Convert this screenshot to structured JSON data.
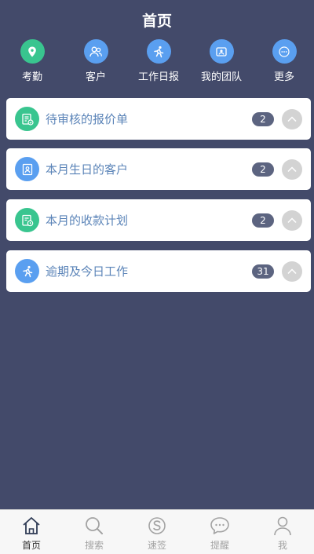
{
  "header": {
    "title": "首页"
  },
  "quick_actions": [
    {
      "label": "考勤",
      "icon": "location-pin-icon",
      "color": "#39c58f"
    },
    {
      "label": "客户",
      "icon": "people-icon",
      "color": "#5a9ff0"
    },
    {
      "label": "工作日报",
      "icon": "runner-icon",
      "color": "#5a9ff0"
    },
    {
      "label": "我的团队",
      "icon": "id-card-icon",
      "color": "#5a9ff0"
    },
    {
      "label": "更多",
      "icon": "more-dots-icon",
      "color": "#5a9ff0"
    }
  ],
  "cards": [
    {
      "label": "待审核的报价单",
      "count": "2",
      "icon": "document-approval-icon",
      "color": "#39c58f"
    },
    {
      "label": "本月生日的客户",
      "count": "2",
      "icon": "birthday-contact-icon",
      "color": "#5a9ff0"
    },
    {
      "label": "本月的收款计划",
      "count": "2",
      "icon": "payment-plan-icon",
      "color": "#39c58f"
    },
    {
      "label": "逾期及今日工作",
      "count": "31",
      "icon": "runner-icon",
      "color": "#5a9ff0"
    }
  ],
  "tabs": [
    {
      "label": "首页",
      "icon": "home-icon",
      "active": true
    },
    {
      "label": "搜索",
      "icon": "search-icon",
      "active": false
    },
    {
      "label": "速签",
      "icon": "quick-sign-icon",
      "active": false
    },
    {
      "label": "提醒",
      "icon": "chat-bubble-icon",
      "active": false
    },
    {
      "label": "我",
      "icon": "person-icon",
      "active": false
    }
  ]
}
